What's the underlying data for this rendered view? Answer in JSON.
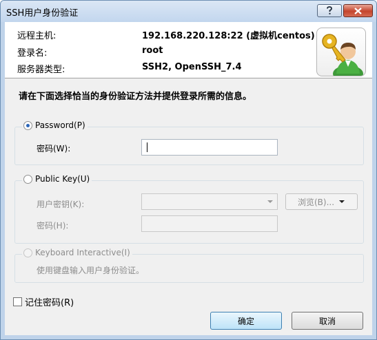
{
  "window": {
    "title": "SSH用户身份验证"
  },
  "info": {
    "remote_host_label": "远程主机:",
    "remote_host_value": "192.168.220.128:22 (虚拟机centos)",
    "login_label": "登录名:",
    "login_value": "root",
    "server_type_label": "服务器类型:",
    "server_type_value": "SSH2, OpenSSH_7.4"
  },
  "instruction": "请在下面选择恰当的身份验证方法并提供登录所需的信息。",
  "password_group": {
    "label": "Password(P)",
    "selected": true,
    "password_label": "密码(W):",
    "password_value": ""
  },
  "publickey_group": {
    "label": "Public Key(U)",
    "selected": false,
    "user_key_label": "用户密钥(K):",
    "user_key_value": "",
    "browse_label": "浏览(B)...",
    "passphrase_label": "密码(H):"
  },
  "keyboard_group": {
    "label": "Keyboard Interactive(I)",
    "description": "使用键盘输入用户身份验证。"
  },
  "remember": {
    "label": "记住密码(R)",
    "checked": false
  },
  "buttons": {
    "ok": "确定",
    "cancel": "取消"
  },
  "colors": {
    "accent": "#2a65b8",
    "close_button": "#c4452d",
    "title_bar": "#c2d6ee"
  }
}
